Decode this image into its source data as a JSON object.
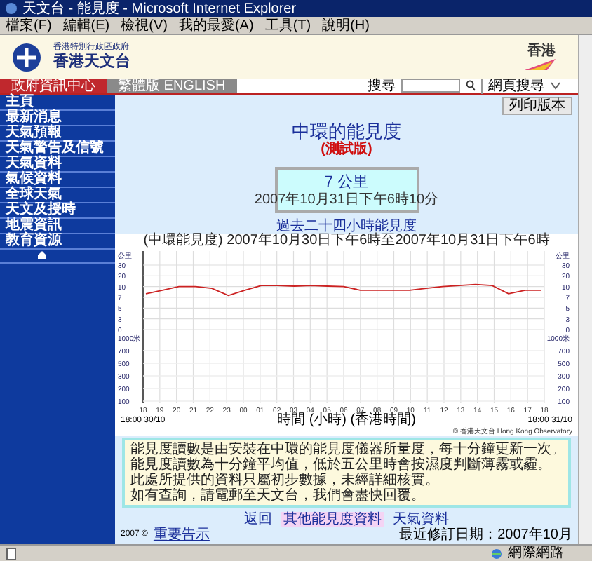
{
  "window": {
    "title": "天文台 - 能見度 - Microsoft Internet Explorer"
  },
  "menu": [
    "檔案(F)",
    "編輯(E)",
    "檢視(V)",
    "我的最愛(A)",
    "工具(T)",
    "說明(H)"
  ],
  "header": {
    "org_line": "香港特別行政區政府",
    "org_name": "香港天文台",
    "region": "香港"
  },
  "tabs": [
    {
      "label": "政府資訊中心",
      "selected": true
    },
    {
      "label": "繁體版 ENGLISH",
      "selected": false
    }
  ],
  "search": {
    "label": "搜尋",
    "scope": "網頁搜尋"
  },
  "sidebar": {
    "items": [
      {
        "label": "主頁"
      },
      {
        "label": "最新消息"
      },
      {
        "label": "天氣預報"
      },
      {
        "label": "天氣警告及信號"
      },
      {
        "label": "天氣資料"
      },
      {
        "label": "氣候資料"
      },
      {
        "label": "全球天氣"
      },
      {
        "label": "天文及授時"
      },
      {
        "label": "地震資訊"
      },
      {
        "label": "教育資源"
      }
    ]
  },
  "print_button": "列印版本",
  "page": {
    "title": "中環的能見度",
    "subtitle": "(測試版)"
  },
  "reading": {
    "value": "7 公里",
    "time": "2007年10月31日下午6時10分"
  },
  "chart_heading": "過去二十四小時能見度",
  "chart_caption": "(中環能見度) 2007年10月30日下午6時至2007年10月31日下午6時",
  "chart": {
    "x_ticks": [
      "18",
      "19",
      "20",
      "21",
      "22",
      "23",
      "00",
      "01",
      "02",
      "03",
      "04",
      "05",
      "06",
      "07",
      "08",
      "09",
      "10",
      "11",
      "12",
      "13",
      "14",
      "15",
      "16",
      "17",
      "18"
    ],
    "left_axis": {
      "unit": "公里",
      "ticks": [
        "30",
        "20",
        "10",
        "7",
        "5",
        "3",
        "0"
      ]
    },
    "right_axis": {
      "unit": "公里",
      "ticks": [
        "30",
        "20",
        "10",
        "7",
        "5",
        "3",
        "0"
      ]
    }
  },
  "lower_axis_left": {
    "unit": "1000米",
    "ticks": [
      "700",
      "500",
      "300",
      "200",
      "100"
    ]
  },
  "lower_axis_right": {
    "unit": "1000米",
    "ticks": [
      "700",
      "500",
      "300",
      "200",
      "100"
    ]
  },
  "x_start": "18:00 30/10",
  "x_end": "18:00 31/10",
  "xlabel": "時間 (小時) (香港時間)",
  "credit": "© 香港天文台 Hong Kong Observatory",
  "notes": [
    "能見度讀數是由安裝在中環的能見度儀器所量度，每十分鐘更新一次。",
    "能見度讀數為十分鐘平均值，低於五公里時會按濕度判斷薄霧或霾。",
    "此處所提供的資料只屬初步數據，未經詳細核實。",
    "如有查詢，請電郵至天文台，我們會盡快回覆。"
  ],
  "links": [
    {
      "label": "返回",
      "selected": false
    },
    {
      "label": "其他能見度資料",
      "selected": true
    },
    {
      "label": "天氣資料",
      "selected": false
    }
  ],
  "footer": {
    "copyright": "2007 ©",
    "link": "重要告示",
    "updated": "最近修訂日期：2007年10月"
  },
  "status_bar": {
    "zone": "網際網路"
  }
}
